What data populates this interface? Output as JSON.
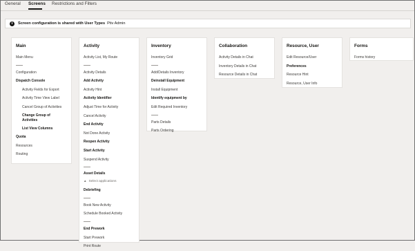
{
  "tabs": [
    "General",
    "Screens",
    "Restrictions and Filters"
  ],
  "banner": {
    "icon": "info-icon",
    "bold": "Screen configuration is shared with User Types",
    "value": "Ptiv Admin"
  },
  "cards": {
    "main": {
      "title": "Main",
      "items": [
        "Main Menu",
        "Configuration",
        "Dispatch Console",
        "Activity Fields for Export",
        "Activity Time View Label",
        "Cancel Group of Activities",
        "Change Group of Activities",
        "List View Columns",
        "Quota",
        "Resources",
        "Routing"
      ]
    },
    "activity": {
      "title": "Activity",
      "items": [
        "Activity List, My Route",
        "Activity Details",
        "Add Activity",
        "Activity Hint",
        "Activity Identifier",
        "Adjust Time for Activity",
        "Cancel Activity",
        "End Activity",
        "Not Done Activity",
        "Reopen Activity",
        "Start Activity",
        "Suspend Activity",
        "Asset Details",
        "Select applications",
        "Debriefing",
        "Book New Activity",
        "Schedule Booked Activity",
        "End Prework",
        "Start Prework",
        "Print Route"
      ]
    },
    "inventory": {
      "title": "Inventory",
      "items": [
        "Inventory Grid",
        "Add/Details Inventory",
        "Deinstall Equipment",
        "Install Equipment",
        "Identify equipment by",
        "Edit Required Inventory",
        "Parts Details",
        "Parts Ordering"
      ]
    },
    "collaboration": {
      "title": "Collaboration",
      "items": [
        "Activity Details in Chat",
        "Inventory Details in Chat",
        "Resource Details in Chat"
      ]
    },
    "resource_user": {
      "title": "Resource, User",
      "items": [
        "Edit Resource/User",
        "Preferences",
        "Resource Hint",
        "Resource, User Info"
      ]
    },
    "forms": {
      "title": "Forms",
      "items": [
        "Forms history"
      ]
    }
  }
}
